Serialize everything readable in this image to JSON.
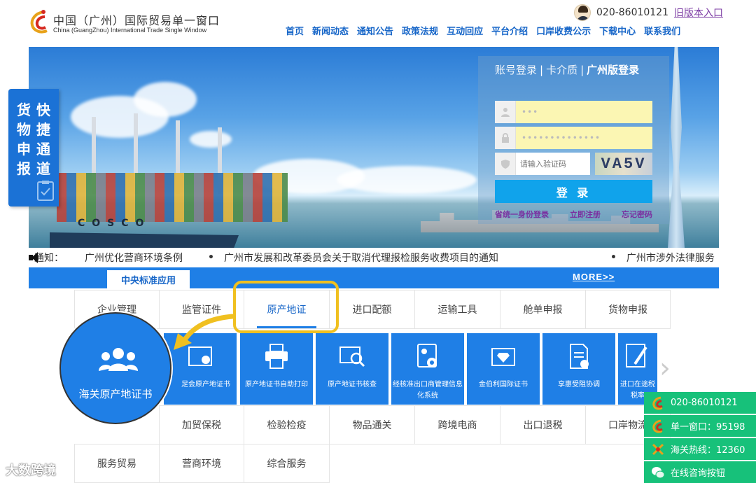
{
  "header": {
    "logo_cn": "中国（广州）国际贸易单一窗口",
    "logo_en": "China (GuangZhou) International Trade Single Window",
    "phone": "020-86010121",
    "old_version_link": "旧版本入口"
  },
  "nav": [
    "首页",
    "新闻动态",
    "通知公告",
    "政策法规",
    "互动回应",
    "平台介绍",
    "口岸收费公示",
    "下载中心",
    "联系我们"
  ],
  "login": {
    "tab_account": "账号登录",
    "tab_card": "卡介质",
    "tab_guangzhou": "广州版登录",
    "username_value": "•••",
    "password_value": "••••••••••••••",
    "captcha_placeholder": "请输入验证码",
    "captcha_text": "VA5V",
    "login_button": "登 录",
    "link_provincial": "省统一身份登录",
    "link_register": "立即注册",
    "link_forgot": "忘记密码"
  },
  "express": {
    "col1": "货物申报",
    "col2": "快捷通道"
  },
  "notice": {
    "label": "通知：",
    "items": [
      "广州优化营商环境条例",
      "广州市发展和改革委员会关于取消代理报检服务收费项目的通知",
      "广州市涉外法律服务"
    ]
  },
  "tabbar": {
    "central_tab": "中央标准应用",
    "more": "MORE>>"
  },
  "grid": {
    "row1": [
      "企业管理",
      "监管证件",
      "原产地证",
      "进口配额",
      "运输工具",
      "舱单申报",
      "货物申报"
    ],
    "row3": [
      "加贸保税",
      "检验检疫",
      "物品通关",
      "跨境电商",
      "出口退税",
      "口岸物流"
    ],
    "row4": [
      "服务贸易",
      "营商环境",
      "综合服务"
    ]
  },
  "tiles": [
    {
      "label": "海关原产地证书",
      "icon": "users-icon"
    },
    {
      "label": "原产地证书自助打印",
      "icon": "printer-icon"
    },
    {
      "label": "原产地证书核查",
      "icon": "certificate-search-icon"
    },
    {
      "label": "经核准出口商管理信息化系统",
      "icon": "exporter-id-icon"
    },
    {
      "label": "金伯利国际证书",
      "icon": "diamond-certificate-icon"
    },
    {
      "label": "享惠受阻协调",
      "icon": "document-coordinate-icon"
    },
    {
      "label": "进口在途税税率",
      "icon": "document-pen-icon"
    }
  ],
  "tile_partial_label": "足会原产地证书",
  "magnifier_label": "海关原产地证书",
  "right_float": [
    {
      "label": "020-86010121",
      "icon": "window-logo-icon"
    },
    {
      "label": "单一窗口：95198",
      "icon": "window-logo-icon"
    },
    {
      "label": "海关热线：12360",
      "icon": "customs-icon"
    },
    {
      "label": "在线咨询按钮",
      "icon": "wechat-icon"
    }
  ],
  "watermark": "大数跨境",
  "colors": {
    "brand_blue": "#1f7fe6",
    "nav_blue": "#1766c8",
    "green": "#17c17a",
    "highlight_yellow": "#f0c020"
  }
}
